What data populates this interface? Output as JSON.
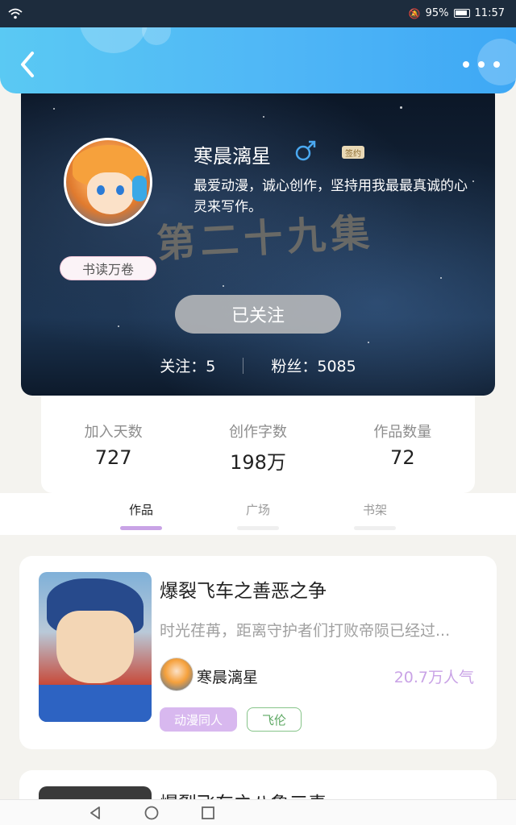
{
  "status_bar": {
    "battery_percent": "95%",
    "time": "11:57"
  },
  "profile": {
    "name": "寒晨漓星",
    "sign_tag": "签约",
    "bio": "最爱动漫，诚心创作，坚持用我最最真诚的心灵来写作。",
    "badge": "书读万卷",
    "follow_button": "已关注",
    "following_text": "关注：5",
    "fans_text": "粉丝：5085",
    "background_text": "第二十九集"
  },
  "stats": [
    {
      "label": "加入天数",
      "value": "727"
    },
    {
      "label": "创作字数",
      "value": "198万"
    },
    {
      "label": "作品数量",
      "value": "72"
    }
  ],
  "tabs": [
    {
      "label": "作品",
      "active": true
    },
    {
      "label": "广场",
      "active": false
    },
    {
      "label": "书架",
      "active": false
    }
  ],
  "works": [
    {
      "title": "爆裂飞车之善恶之争",
      "description": "时光荏苒，距离守护者们打败帝陨已经过...",
      "author": "寒晨漓星",
      "popularity": "20.7万人气",
      "tags": [
        "动漫同人",
        "飞伦"
      ]
    },
    {
      "title": "爆裂飞车之八鲁三毒"
    }
  ],
  "colors": {
    "header_blue": "#4fb6f6",
    "accent_purple": "#c9a3e6",
    "tag_green": "#5ea863"
  }
}
